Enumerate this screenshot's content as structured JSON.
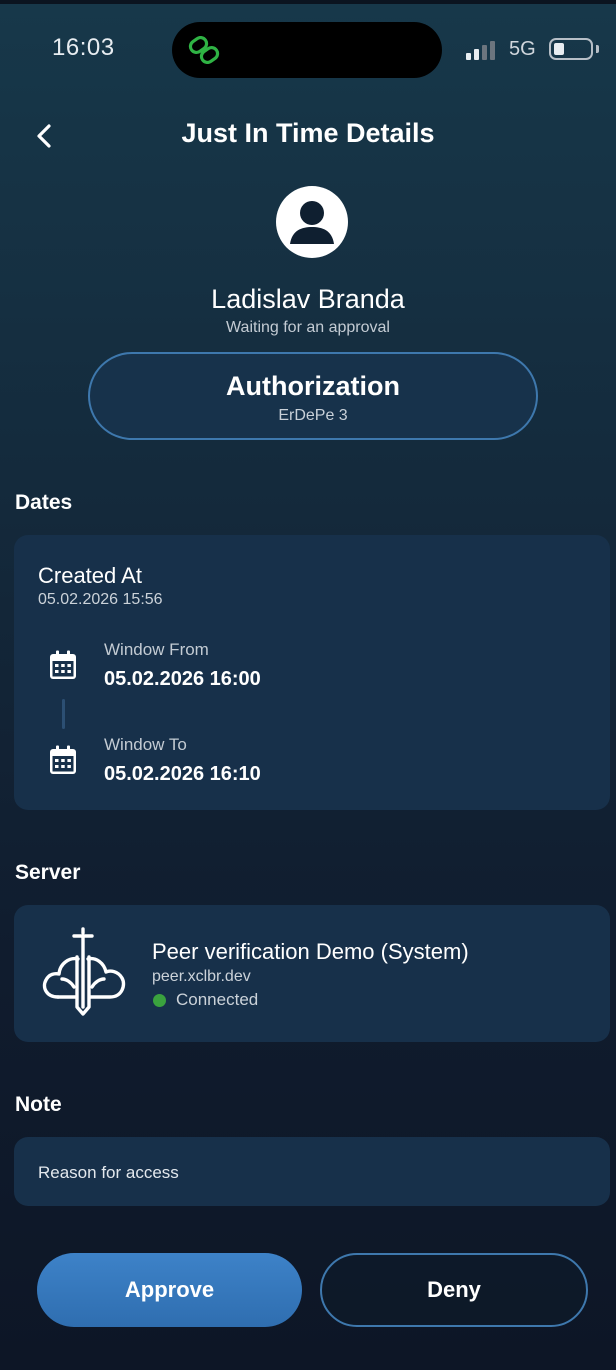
{
  "status_bar": {
    "time": "16:03",
    "network": "5G",
    "island_icon": "link-icon",
    "colors": {
      "island_icon": "#2fb344"
    }
  },
  "header": {
    "title": "Just In Time Details",
    "back_icon": "chevron-left-icon"
  },
  "user": {
    "name": "Ladislav Branda",
    "status": "Waiting for an approval",
    "avatar_icon": "user-avatar-icon"
  },
  "request": {
    "type": "Authorization",
    "target": "ErDePe 3"
  },
  "dates": {
    "section_title": "Dates",
    "created_label": "Created At",
    "created_value": "05.02.2026 15:56",
    "window_from_label": "Window From",
    "window_from_value": "05.02.2026 16:00",
    "window_to_label": "Window To",
    "window_to_value": "05.02.2026 16:10"
  },
  "server": {
    "section_title": "Server",
    "name": "Peer verification Demo (System)",
    "host": "peer.xclbr.dev",
    "status": "Connected",
    "logo_icon": "cloud-sword-logo-icon",
    "colors": {
      "status": "#3aa23e"
    }
  },
  "note": {
    "section_title": "Note",
    "text": "Reason for access"
  },
  "actions": {
    "approve_label": "Approve",
    "deny_label": "Deny"
  },
  "colors": {
    "accent": "#3d82c8",
    "card_bg": "#17304a",
    "outline": "#3e78ad"
  }
}
